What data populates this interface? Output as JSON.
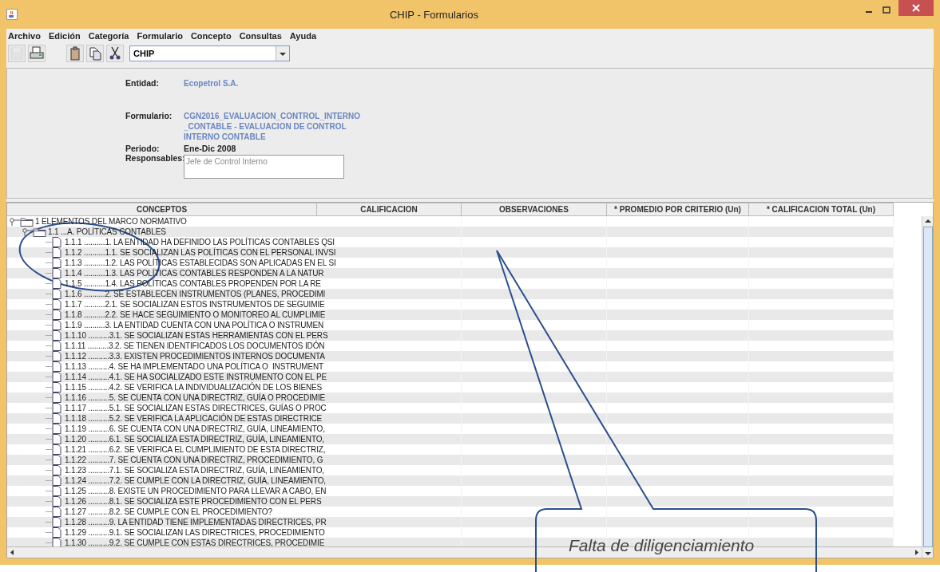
{
  "window": {
    "title": "CHIP - Formularios"
  },
  "menu": [
    "Archivo",
    "Edición",
    "Categoría",
    "Formulario",
    "Concepto",
    "Consultas",
    "Ayuda"
  ],
  "toolbar": {
    "groups": [
      [
        {
          "kind": "save",
          "disabled": true
        },
        {
          "kind": "print",
          "disabled": false
        }
      ],
      [
        {
          "kind": "paste",
          "disabled": false
        },
        {
          "kind": "copy",
          "disabled": false
        },
        {
          "kind": "cut",
          "disabled": false
        }
      ]
    ],
    "combo_value": "CHIP"
  },
  "info": {
    "fields": [
      {
        "label": "Entidad:",
        "value": "Ecopetrol S.A.",
        "kind": "link"
      },
      {
        "label": "Formulario:",
        "value": "CGN2016_EVALUACION_CONTROL_INTERNO _CONTABLE - EVALUACION DE CONTROL INTERNO CONTABLE",
        "kind": "link"
      },
      {
        "label": "Periodo:",
        "value": "Ene-Dic 2008",
        "kind": "text"
      },
      {
        "label": "Responsables:",
        "value": "Jefe de Control Interno",
        "kind": "area"
      }
    ]
  },
  "table": {
    "columns": [
      "CONCEPTOS",
      "CALIFICACION",
      "OBSERVACIONES",
      "* PROMEDIO POR CRITERIO (Un)",
      "* CALIFICACION TOTAL (Un)"
    ],
    "tree": [
      {
        "label": "1 ELEMENTOS DEL MARCO NORMATIVO",
        "expanded": true,
        "children": [
          {
            "label": "1.1 ...A. POLÍTICAS CONTABLES",
            "expanded": true,
            "children": [
              {
                "label": "1.1.1 ..........1. LA ENTIDAD HA DEFINIDO LAS POLÍTICAS CONTABLES QSI"
              },
              {
                "label": "1.1.2 ..........1.1. SE SOCIALIZAN LAS POLÍTICAS CON EL PERSONAL INVSI"
              },
              {
                "label": "1.1.3 ..........1.2. LAS POLÍTICAS ESTABLECIDAS SON APLICADAS EN EL SI"
              },
              {
                "label": "1.1.4 ..........1.3. LAS POLÍTICAS CONTABLES RESPONDEN A LA NATUR"
              },
              {
                "label": "1.1.5 ..........1.4. LAS POLÍTICAS CONTABLES PROPENDEN POR LA RE"
              },
              {
                "label": "1.1.6 ..........2. SE ESTABLECEN INSTRUMENTOS (PLANES, PROCEDIMI"
              },
              {
                "label": "1.1.7 ..........2.1. SE SOCIALIZAN ESTOS INSTRUMENTOS DE SEGUIMIE"
              },
              {
                "label": "1.1.8 ..........2.2. SE HACE SEGUIMIENTO O MONITOREO AL CUMPLIMIE"
              },
              {
                "label": "1.1.9 ..........3. LA ENTIDAD CUENTA CON UNA POLÍTICA O INSTRUMEN"
              },
              {
                "label": "1.1.10 ..........3.1. SE SOCIALIZAN ESTAS HERRAMIENTAS CON EL PERS"
              },
              {
                "label": "1.1.11 ..........3.2. SE TIENEN IDENTIFICADOS LOS DOCUMENTOS IDÓN"
              },
              {
                "label": "1.1.12 ..........3.3. EXISTEN PROCEDIMIENTOS INTERNOS DOCUMENTA"
              },
              {
                "label": "1.1.13 ..........4. SE HA IMPLEMENTADO UNA POLÍTICA O  INSTRUMENT"
              },
              {
                "label": "1.1.14 ..........4.1. SE HA SOCIALIZADO ESTE INSTRUMENTO CON EL PE"
              },
              {
                "label": "1.1.15 ..........4.2. SE VERIFICA LA INDIVIDUALIZACIÓN DE LOS BIENES"
              },
              {
                "label": "1.1.16 ..........5. SE CUENTA CON UNA DIRECTRIZ, GUÍA O PROCEDIMIE"
              },
              {
                "label": "1.1.17 ..........5.1. SE SOCIALIZAN ESTAS DIRECTRICES, GUÍAS O PROC"
              },
              {
                "label": "1.1.18 ..........5.2. SE VERIFICA LA APLICACIÓN DE ESTAS DIRECTRICE"
              },
              {
                "label": "1.1.19 ..........6. SE CUENTA CON UNA DIRECTRIZ, GUÍA, LINEAMIENTO,"
              },
              {
                "label": "1.1.20 ..........6.1. SE SOCIALIZA ESTA DIRECTRIZ, GUÍA, LINEAMIENTO,"
              },
              {
                "label": "1.1.21 ..........6.2. SE VERIFICA EL CUMPLIMIENTO DE ESTA DIRECTRIZ,"
              },
              {
                "label": "1.1.22 ..........7. SE CUENTA CON UNA DIRECTRIZ, PROCEDIMIENTO, G"
              },
              {
                "label": "1.1.23 ..........7.1. SE SOCIALIZA ESTA DIRECTRIZ, GUÍA, LINEAMIENTO,"
              },
              {
                "label": "1.1.24 ..........7.2. SE CUMPLE CON LA DIRECTRIZ, GUÍA, LINEAMIENTO,"
              },
              {
                "label": "1.1.25 ..........8. EXISTE UN PROCEDIMIENTO PARA LLEVAR A CABO, EN"
              },
              {
                "label": "1.1.26 ..........8.1. SE SOCIALIZA ESTE PROCEDIMIENTO CON EL PERS"
              },
              {
                "label": "1.1.27 ..........8.2. SE CUMPLE CON EL PROCEDIMIENTO?"
              },
              {
                "label": "1.1.28 ..........9. LA ENTIDAD TIENE IMPLEMENTADAS DIRECTRICES, PR"
              },
              {
                "label": "1.1.29 ..........9.1. SE SOCIALIZAN LAS DIRECTRICES, PROCEDIMIENTO"
              },
              {
                "label": "1.1.30 ..........9.2. SE CUMPLE CON ESTAS DIRECTRICES, PROCEDIMIE"
              }
            ]
          }
        ]
      }
    ]
  },
  "annotation": {
    "callout_text": "Falta de diligenciamiento"
  }
}
